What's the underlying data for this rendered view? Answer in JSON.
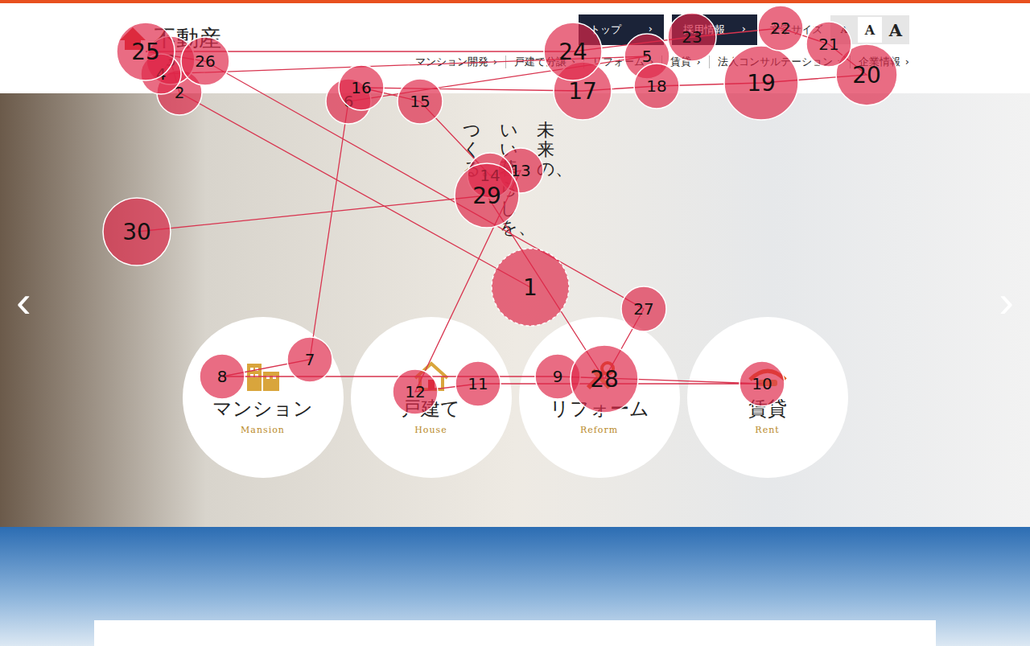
{
  "header": {
    "logo": "不動産",
    "utility_buttons": [
      {
        "label": "トップ",
        "arrow": "›"
      },
      {
        "label": "採用情報",
        "arrow": "›"
      }
    ],
    "font_size": {
      "label": "文字サイズ",
      "options": [
        "A",
        "A",
        "A"
      ]
    },
    "nav": [
      {
        "label": "マンション開発",
        "arrow": "›"
      },
      {
        "label": "戸建て分譲",
        "arrow": "›"
      },
      {
        "label": "リフォーム",
        "arrow": "›"
      },
      {
        "label": "賃貸",
        "arrow": "›"
      },
      {
        "label": "法人コンサルテーション",
        "arrow": "›"
      },
      {
        "label": "企業情報",
        "arrow": "›"
      }
    ]
  },
  "hero": {
    "tagline": [
      "未来の、",
      "いい暮らしを、",
      "つくる。"
    ],
    "prev": "‹",
    "next": "›",
    "categories": [
      {
        "label": "マンション",
        "sub": "Mansion",
        "kind": "mansion"
      },
      {
        "label": "戸建て",
        "sub": "House",
        "kind": "house"
      },
      {
        "label": "リフォーム",
        "sub": "Reform",
        "kind": "reform"
      },
      {
        "label": "賃貸",
        "sub": "Rent",
        "kind": "rent"
      }
    ]
  },
  "fixations": [
    {
      "label": "1",
      "first": true
    },
    {
      "label": "2",
      "first": false
    },
    {
      "label": "3",
      "first": false
    },
    {
      "label": "4",
      "first": false
    },
    {
      "label": "5",
      "first": false
    },
    {
      "label": "6",
      "first": false
    },
    {
      "label": "7",
      "first": false
    },
    {
      "label": "8",
      "first": false
    },
    {
      "label": "9",
      "first": false
    },
    {
      "label": "10",
      "first": false
    },
    {
      "label": "11",
      "first": false
    },
    {
      "label": "12",
      "first": false
    },
    {
      "label": "13",
      "first": false
    },
    {
      "label": "14",
      "first": false
    },
    {
      "label": "15",
      "first": false
    },
    {
      "label": "16",
      "first": false
    },
    {
      "label": "17",
      "first": false
    },
    {
      "label": "18",
      "first": false
    },
    {
      "label": "19",
      "first": false
    },
    {
      "label": "20",
      "first": false
    },
    {
      "label": "21",
      "first": false
    },
    {
      "label": "22",
      "first": false
    },
    {
      "label": "23",
      "first": false
    },
    {
      "label": "24",
      "first": false
    },
    {
      "label": "25",
      "first": false
    },
    {
      "label": "26",
      "first": false
    },
    {
      "label": "27",
      "first": false
    },
    {
      "label": "28",
      "first": false
    },
    {
      "label": "29",
      "first": false
    },
    {
      "label": "30",
      "first": false
    }
  ]
}
